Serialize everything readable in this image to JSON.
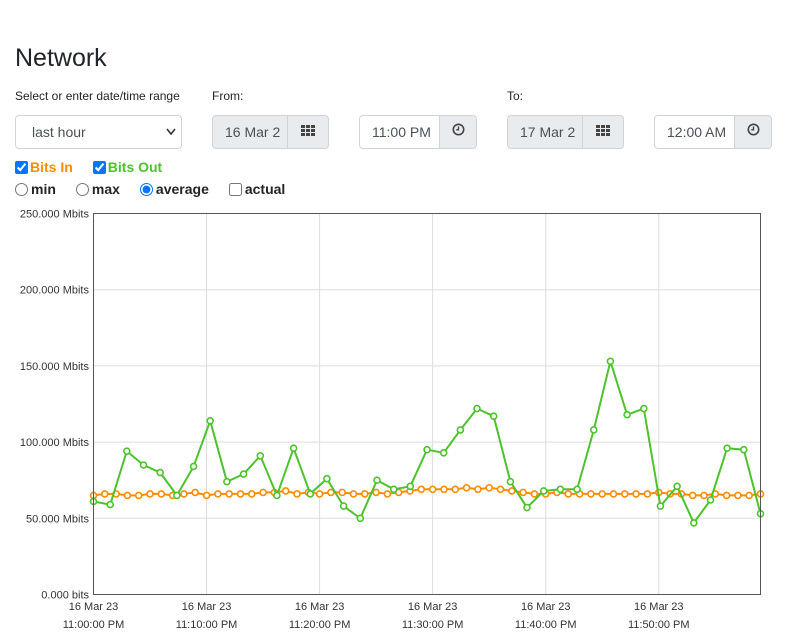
{
  "page": {
    "title": "Network"
  },
  "range": {
    "label": "Select or enter date/time range",
    "selected": "last hour"
  },
  "from": {
    "label": "From:",
    "date": "16 Mar 2",
    "time": "11:00 PM"
  },
  "to": {
    "label": "To:",
    "date": "17 Mar 2",
    "time": "12:00 AM"
  },
  "series_toggles": [
    {
      "label": "Bits In",
      "checked": true,
      "color": "#ff8c00"
    },
    {
      "label": "Bits Out",
      "checked": true,
      "color": "#4cc32b"
    }
  ],
  "modes": [
    {
      "label": "min",
      "type": "radio",
      "checked": false
    },
    {
      "label": "max",
      "type": "radio",
      "checked": false
    },
    {
      "label": "average",
      "type": "radio",
      "checked": true
    },
    {
      "label": "actual",
      "type": "checkbox",
      "checked": false
    }
  ],
  "icons": {
    "calendar": "calendar-grid-icon",
    "clock": "clock-icon"
  },
  "chart_data": {
    "type": "line",
    "y_ticks": [
      "0.000 bits",
      "50.000 Mbits",
      "100.000 Mbits",
      "150.000 Mbits",
      "200.000 Mbits",
      "250.000 Mbits"
    ],
    "ylim": [
      0,
      250
    ],
    "xlim": [
      0,
      59
    ],
    "x_ticks": [
      {
        "pos": 10,
        "date": "16 Mar 23",
        "time": "11:00:00 PM",
        "v": 0
      },
      {
        "date": "16 Mar 23",
        "time": "11:10:00 PM",
        "v": 10
      },
      {
        "date": "16 Mar 23",
        "time": "11:20:00 PM",
        "v": 20
      },
      {
        "date": "16 Mar 23",
        "time": "11:30:00 PM",
        "v": 30
      },
      {
        "date": "16 Mar 23",
        "time": "11:40:00 PM",
        "v": 40
      },
      {
        "date": "16 Mar 23",
        "time": "11:50:00 PM",
        "v": 50
      }
    ],
    "grid": true,
    "series": [
      {
        "name": "Bits In",
        "color": "#ff8c00",
        "values": [
          65,
          66,
          66,
          65,
          65,
          66,
          66,
          65,
          66,
          67,
          65,
          66,
          66,
          66,
          66,
          67,
          67,
          68,
          66,
          67,
          66,
          67,
          67,
          66,
          66,
          67,
          66,
          67,
          68,
          69,
          69,
          69,
          69,
          70,
          69,
          70,
          69,
          68,
          67,
          66,
          66,
          67,
          66,
          66,
          66,
          66,
          66,
          66,
          66,
          66,
          67,
          66,
          66,
          65,
          65,
          66,
          65,
          65,
          65,
          66
        ]
      },
      {
        "name": "Bits Out",
        "color": "#4cc32b",
        "values": [
          61,
          59,
          94,
          85,
          80,
          65,
          84,
          114,
          74,
          79,
          91,
          65,
          96,
          66,
          76,
          58,
          50,
          75,
          69,
          71,
          95,
          93,
          108,
          122,
          117,
          74,
          57,
          68,
          69,
          69,
          108,
          153,
          118,
          122,
          58,
          71,
          47,
          62,
          96,
          95,
          53
        ]
      }
    ]
  }
}
